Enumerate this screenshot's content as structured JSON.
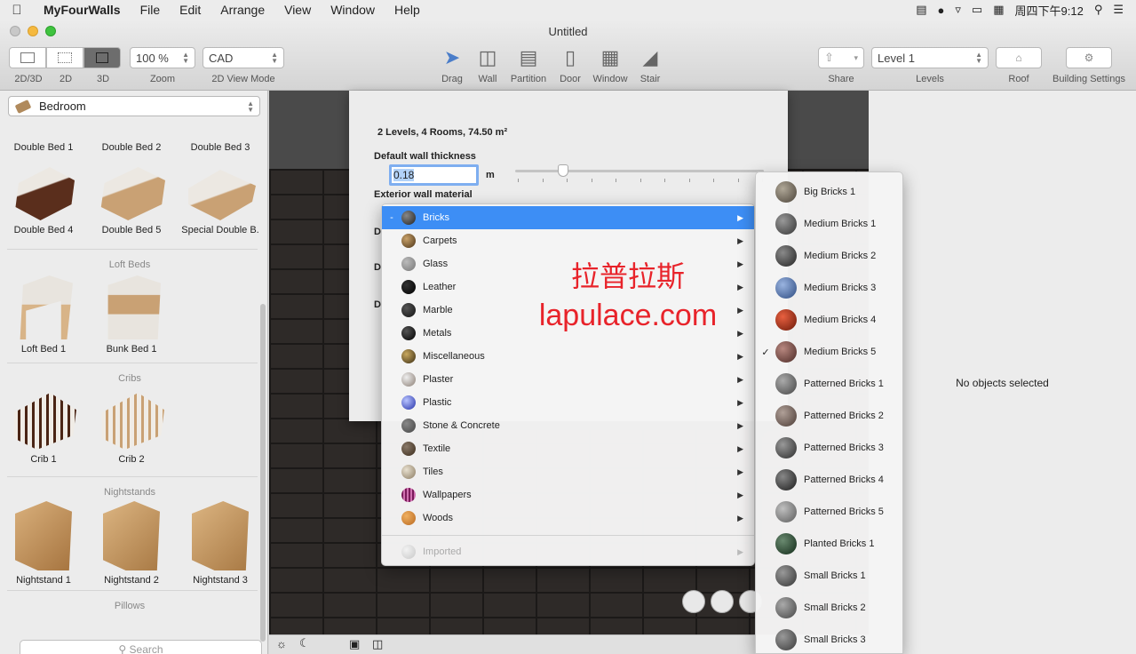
{
  "menubar": {
    "app": "MyFourWalls",
    "items": [
      "File",
      "Edit",
      "Arrange",
      "View",
      "Window",
      "Help"
    ],
    "clock": "周四下午9:12"
  },
  "window": {
    "title": "Untitled"
  },
  "toolbar": {
    "view_labels": [
      "2D/3D",
      "2D",
      "3D"
    ],
    "zoom_value": "100 %",
    "zoom_label": "Zoom",
    "view_mode_value": "CAD",
    "view_mode_label": "2D View Mode",
    "tools": [
      "Drag",
      "Wall",
      "Partition",
      "Door",
      "Window",
      "Stair"
    ],
    "share_label": "Share",
    "level_value": "Level 1",
    "levels_label": "Levels",
    "roof_label": "Roof",
    "building_settings_label": "Building Settings"
  },
  "sidebar": {
    "category": "Bedroom",
    "row1": [
      "Double Bed 1",
      "Double Bed 2",
      "Double Bed 3"
    ],
    "row2": [
      "Double Bed 4",
      "Double Bed 5",
      "Special Double B."
    ],
    "section_loft": "Loft Beds",
    "loft": [
      "Loft Bed 1",
      "Bunk Bed 1"
    ],
    "section_cribs": "Cribs",
    "cribs": [
      "Crib 1",
      "Crib 2"
    ],
    "section_nightstands": "Nightstands",
    "nightstands": [
      "Nightstand 1",
      "Nightstand 2",
      "Nightstand 3"
    ],
    "section_pillows": "Pillows",
    "search_placeholder": "Search"
  },
  "sheet": {
    "summary": "2 Levels, 4 Rooms, 74.50 m²",
    "wall_thickness_label": "Default wall thickness",
    "wall_thickness_value": "0.18",
    "wall_thickness_unit": "m",
    "exterior_label": "Exterior wall material",
    "cut_labels": [
      "D",
      "D",
      "D"
    ]
  },
  "material_menu": {
    "dash": "-",
    "items": [
      "Bricks",
      "Carpets",
      "Glass",
      "Leather",
      "Marble",
      "Metals",
      "Miscellaneous",
      "Plaster",
      "Plastic",
      "Stone & Concrete",
      "Textile",
      "Tiles",
      "Wallpapers",
      "Woods"
    ],
    "imported": "Imported"
  },
  "bricks_menu": {
    "items": [
      "Big Bricks 1",
      "Medium Bricks 1",
      "Medium Bricks 2",
      "Medium Bricks 3",
      "Medium Bricks 4",
      "Medium Bricks 5",
      "Patterned Bricks 1",
      "Patterned Bricks 2",
      "Patterned Bricks 3",
      "Patterned Bricks 4",
      "Patterned Bricks 5",
      "Planted Bricks 1",
      "Small Bricks 1",
      "Small Bricks 2",
      "Small Bricks 3"
    ],
    "checkmark": "✓"
  },
  "watermark": {
    "cn": "拉普拉斯",
    "en": "lapulace.com"
  },
  "inspector": {
    "empty_message": "No objects selected"
  }
}
